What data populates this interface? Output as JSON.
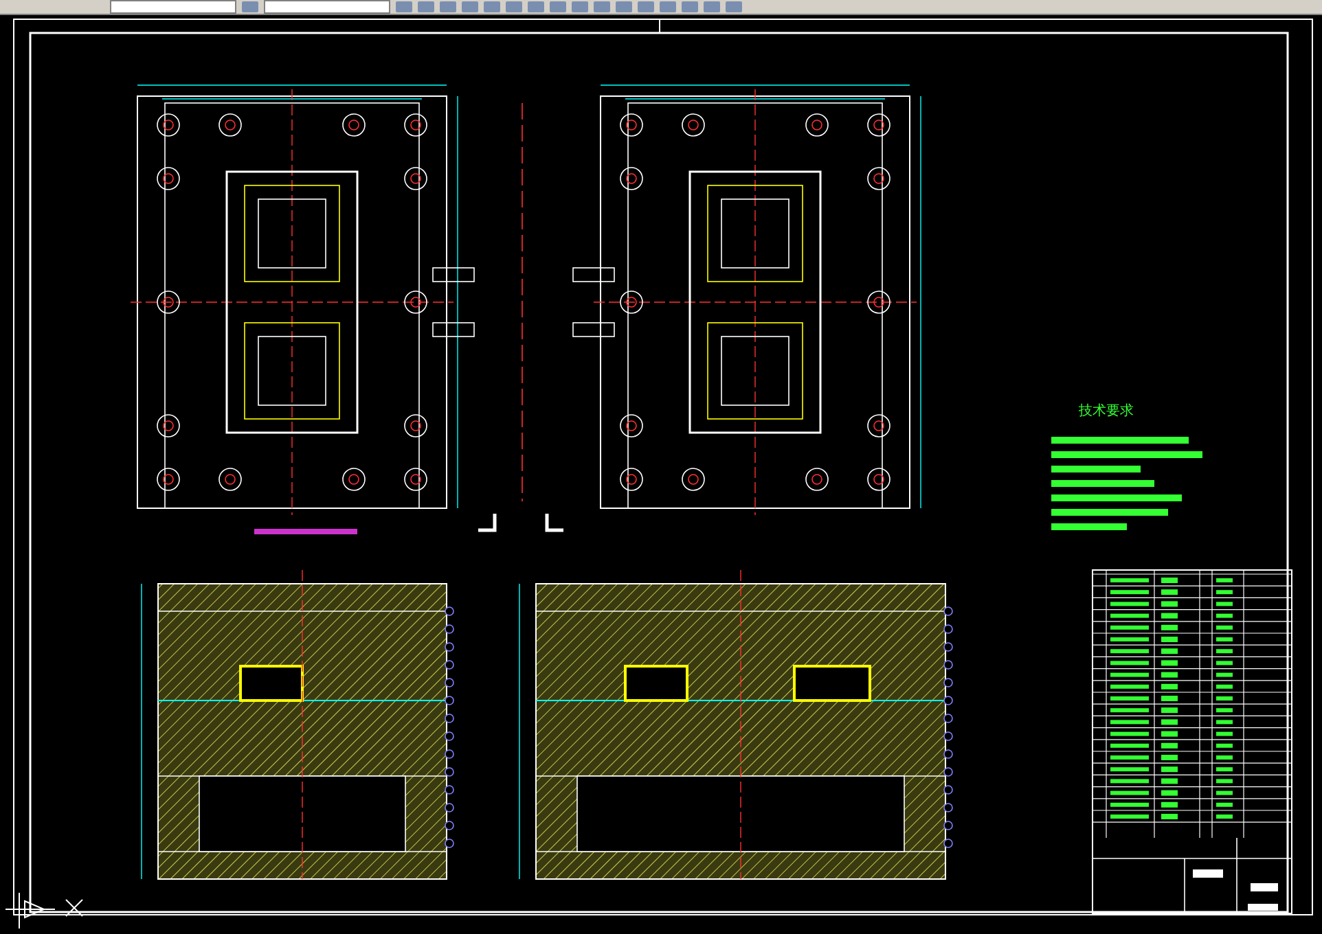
{
  "toolbar": {
    "items": [
      {
        "kind": "field"
      },
      {
        "kind": "icon"
      },
      {
        "kind": "field"
      },
      {
        "kind": "icon"
      },
      {
        "kind": "icon"
      },
      {
        "kind": "icon"
      },
      {
        "kind": "icon"
      },
      {
        "kind": "icon"
      },
      {
        "kind": "icon"
      },
      {
        "kind": "icon"
      },
      {
        "kind": "icon"
      },
      {
        "kind": "icon"
      },
      {
        "kind": "icon"
      },
      {
        "kind": "icon"
      },
      {
        "kind": "icon"
      },
      {
        "kind": "icon"
      },
      {
        "kind": "icon"
      },
      {
        "kind": "icon"
      },
      {
        "kind": "icon"
      }
    ]
  },
  "views": [
    {
      "kind": "plan"
    },
    {
      "kind": "plan"
    },
    {
      "kind": "section"
    },
    {
      "kind": "section"
    }
  ],
  "notes": {
    "title": "技术要求"
  }
}
